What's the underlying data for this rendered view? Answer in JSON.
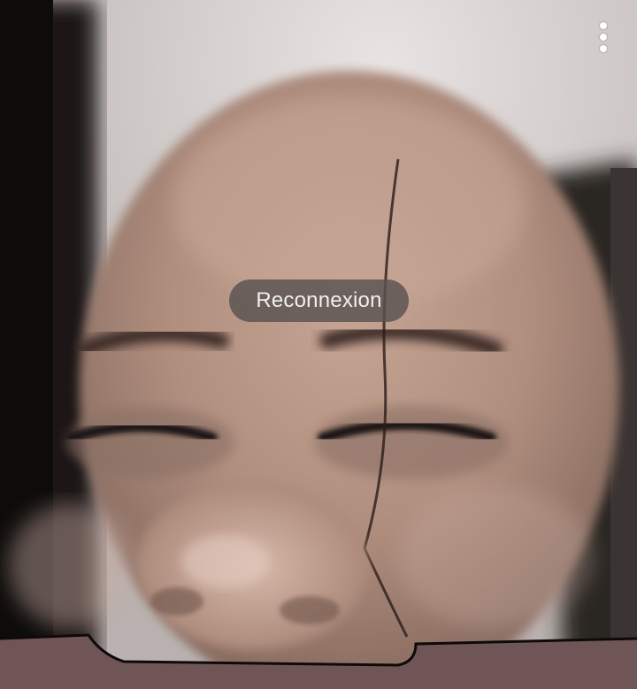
{
  "call": {
    "status_text": "Reconnexion"
  },
  "menu": {
    "icon": "more-vertical-icon"
  },
  "video": {
    "subject": "remote-camera-feed"
  },
  "colors": {
    "toast_background": "#585250",
    "toast_text": "#f2efed",
    "menu_icon": "#ffffff"
  }
}
